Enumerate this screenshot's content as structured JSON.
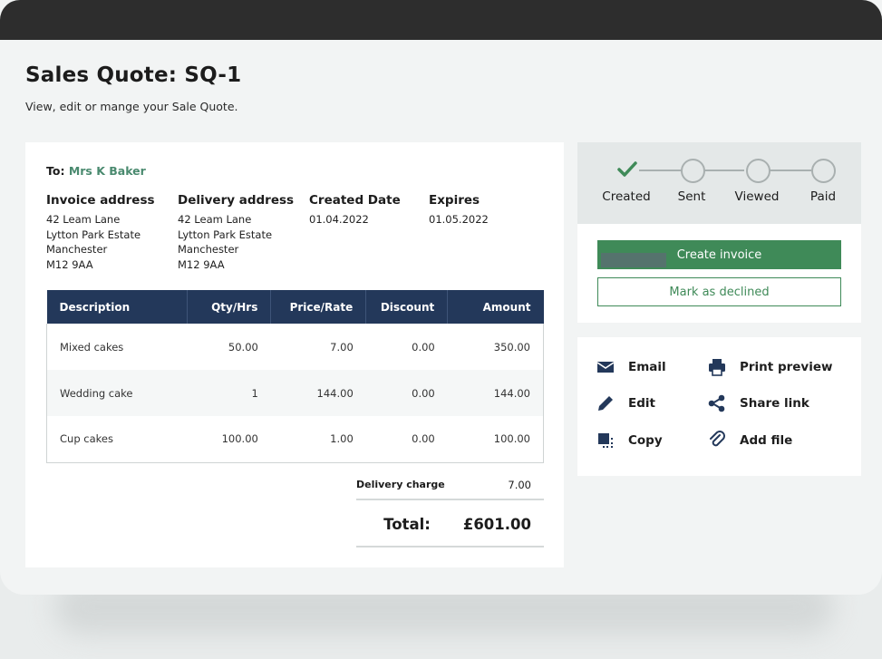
{
  "page": {
    "title": "Sales Quote: SQ-1",
    "subtitle": "View, edit or mange your Sale Quote."
  },
  "quote": {
    "to_label": "To:",
    "to_name": "Mrs K Baker",
    "invoice_address": {
      "heading": "Invoice address",
      "lines": [
        "42 Leam Lane",
        "Lytton Park Estate",
        "Manchester",
        "M12 9AA"
      ]
    },
    "delivery_address": {
      "heading": "Delivery address",
      "lines": [
        "42 Leam Lane",
        "Lytton Park Estate",
        "Manchester",
        "M12 9AA"
      ]
    },
    "created": {
      "heading": "Created Date",
      "value": "01.04.2022"
    },
    "expires": {
      "heading": "Expires",
      "value": "01.05.2022"
    },
    "table": {
      "headers": [
        "Description",
        "Qty/Hrs",
        "Price/Rate",
        "Discount",
        "Amount"
      ],
      "rows": [
        [
          "Mixed cakes",
          "50.00",
          "7.00",
          "0.00",
          "350.00"
        ],
        [
          "Wedding cake",
          "1",
          "144.00",
          "0.00",
          "144.00"
        ],
        [
          "Cup cakes",
          "100.00",
          "1.00",
          "0.00",
          "100.00"
        ]
      ]
    },
    "delivery_charge": {
      "label": "Delivery charge",
      "value": "7.00"
    },
    "total": {
      "label": "Total:",
      "value": "£601.00"
    }
  },
  "status": {
    "steps": [
      {
        "label": "Created",
        "done": true
      },
      {
        "label": "Sent",
        "done": false
      },
      {
        "label": "Viewed",
        "done": false
      },
      {
        "label": "Paid",
        "done": false
      }
    ],
    "primary_button": "Create invoice",
    "secondary_button": "Mark as declined",
    "accent_color": "#3f8a58"
  },
  "actions": {
    "email": {
      "label": "Email",
      "icon": "envelope-icon"
    },
    "print": {
      "label": "Print preview",
      "icon": "printer-icon"
    },
    "edit": {
      "label": "Edit",
      "icon": "pencil-icon"
    },
    "share": {
      "label": "Share link",
      "icon": "share-icon"
    },
    "copy": {
      "label": "Copy",
      "icon": "copy-icon"
    },
    "addfile": {
      "label": "Add file",
      "icon": "paperclip-icon"
    }
  }
}
